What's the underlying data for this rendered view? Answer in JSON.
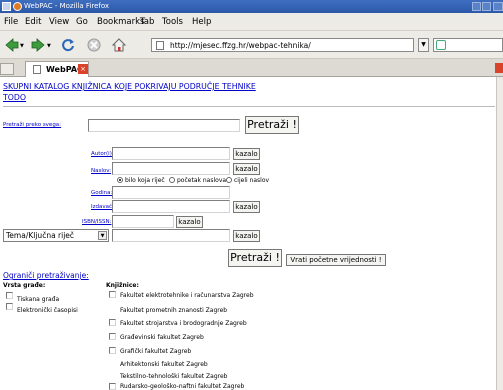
{
  "window": {
    "title": "WebPAC - Mozilla Firefox"
  },
  "menu": {
    "items": [
      "File",
      "Edit",
      "View",
      "Go",
      "Bookmarks",
      "Tab",
      "Tools",
      "Help"
    ]
  },
  "nav": {
    "url": "http://mjesec.ffzg.hr/webpac-tehnika/"
  },
  "tabs": [
    {
      "label": "WebPAC"
    }
  ],
  "page": {
    "heading": "SKUPNI KATALOG KNJIŽNICA KOJE POKRIVAJU PODRUČJE TEHNIKE",
    "todo": "TODO",
    "search_all_label": "Pretraži preko svega:",
    "search_button": "Pretraži !",
    "fields": {
      "autori": "Autor(i):",
      "naslov": "Naslov:",
      "godina": "Godina:",
      "izdavac": "Izdavač:",
      "isbn": "ISBN/ISSN:"
    },
    "kazalo": "kazalo",
    "radio_options": [
      "bilo koja riječ",
      "početak naslova",
      "cijeli naslov"
    ],
    "select_value": "Tema/Ključna riječ",
    "reset_button": "Vrati početne vrijednosti !",
    "limit_label": "Ograniči pretraživanje:",
    "material_heading": "Vrsta građe:",
    "materials": [
      "Tiskana građa",
      "Elektronički časopisi"
    ],
    "libraries_heading": "Knjižnice:",
    "libraries": [
      "Fakultet elektrotehnike i računarstva Zagreb",
      "Fakultet prometnih znanosti Zagreb",
      "Fakultet strojarstva i brodogradnje Zagreb",
      "Građevinski fakultet Zagreb",
      "Grafički fakultet Zagreb",
      "Arhitektonski fakultet Zagreb",
      "Tekstilno-tehnološki fakultet Zagreb",
      "Rudarsko-geološko-naftni fakultet Zagreb"
    ]
  }
}
